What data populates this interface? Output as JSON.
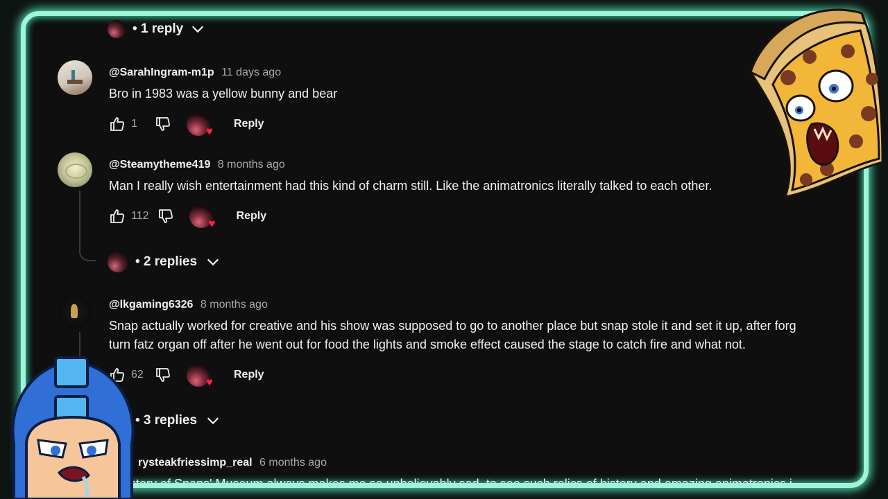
{
  "colors": {
    "frame": "#9ef5da",
    "background": "#0f0f0f",
    "heart": "#ff1d4e",
    "text": "#f1f1f1",
    "muted": "#aaaaaa"
  },
  "top_replies": {
    "label": "• 1 reply"
  },
  "comments": [
    {
      "handle": "@SarahIngram-m1p",
      "time": "11 days ago",
      "text": "Bro in 1983 was a yellow bunny and bear",
      "likes": "1",
      "reply_label": "Reply"
    },
    {
      "handle": "@Steamytheme419",
      "time": "8 months ago",
      "text": "Man I really wish entertainment had this kind of charm still. Like the animatronics literally talked to each other.",
      "likes": "112",
      "reply_label": "Reply",
      "replies_label": "• 2 replies"
    },
    {
      "handle": "@lkgaming6326",
      "time": "8 months ago",
      "text_line1": "Snap actually worked for creative and his show was supposed to go to another place but snap stole it and set it up, after forg",
      "text_line2": "turn fatz organ off after he went out for food the lights and smoke effect caused the stage to catch fire and what not.",
      "likes": "62",
      "reply_label": "Reply",
      "replies_label": "• 3 replies"
    },
    {
      "handle": "rysteakfriessimp_real",
      "time": "6 months ago",
      "text": "the story of Snaps' Museum always makes me so unbelievably sad. to see such relics of history and amazing animatronics i"
    }
  ],
  "icons": [
    "thumbs-up-icon",
    "thumbs-down-icon",
    "heart-icon",
    "chevron-down-icon"
  ]
}
